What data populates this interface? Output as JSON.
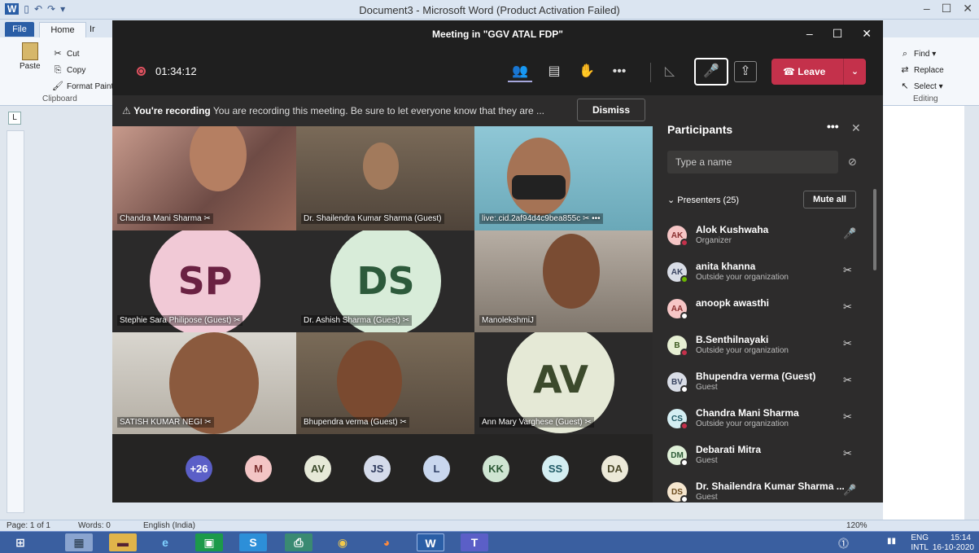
{
  "word": {
    "title": "Document3 - Microsoft Word (Product Activation Failed)",
    "quick_access": [
      "W",
      "▯",
      "↶",
      "↷",
      "▾"
    ],
    "window_controls": [
      "–",
      "☐",
      "✕"
    ],
    "tabs": {
      "file": "File",
      "home": "Home",
      "insert_partial": "Ir"
    },
    "clipboard": {
      "paste": "Paste",
      "cut": "Cut",
      "copy": "Copy",
      "format_painter": "Format Painte",
      "group": "Clipboard"
    },
    "editing": {
      "find": "Find ▾",
      "replace": "Replace",
      "select": "Select ▾",
      "group": "Editing"
    },
    "ruler_corner": "L",
    "status": {
      "page": "Page: 1 of 1",
      "words": "Words: 0",
      "language": "English (India)",
      "zoom": "120%"
    }
  },
  "teams": {
    "window_title": "Meeting in \"GGV ATAL FDP\"",
    "window_controls": [
      "–",
      "☐",
      "✕"
    ],
    "timer": "01:34:12",
    "leave_label": "Leave",
    "recording": {
      "title": "You're recording",
      "message": "You are recording this meeting. Be sure to let everyone know that they are ...",
      "dismiss": "Dismiss"
    },
    "tiles": [
      {
        "name": "Chandra Mani Sharma"
      },
      {
        "name": "Dr. Shailendra Kumar Sharma (Guest)"
      },
      {
        "name": "live:.cid.2af94d4c9bea855c"
      },
      {
        "name": "Stephie Sara Philipose (Guest)",
        "initials": "SP"
      },
      {
        "name": "Dr. Ashish Sharma (Guest)",
        "initials": "DS"
      },
      {
        "name": "ManolekshmiJ"
      },
      {
        "name": "SATISH KUMAR NEGI"
      },
      {
        "name": "Bhupendra verma (Guest)"
      },
      {
        "name": "Ann Mary Varghese (Guest)",
        "initials": "AV"
      }
    ],
    "overflow": [
      {
        "label": "+26",
        "color": "#5b5fc7",
        "text": "#ffffff"
      },
      {
        "label": "M",
        "color": "#f3c5c5",
        "text": "#7a2f2f"
      },
      {
        "label": "AV",
        "color": "#e6e9d8",
        "text": "#3c4a2c"
      },
      {
        "label": "JS",
        "color": "#d5dbea",
        "text": "#2f3a5c"
      },
      {
        "label": "L",
        "color": "#c9d7ee",
        "text": "#2f3f66"
      },
      {
        "label": "KK",
        "color": "#cfe5d2",
        "text": "#2c5a36"
      },
      {
        "label": "SS",
        "color": "#d4eef2",
        "text": "#205a66"
      },
      {
        "label": "DA",
        "color": "#ece9d8",
        "text": "#4d4a2c"
      }
    ],
    "panel": {
      "title": "Participants",
      "more": "•••",
      "close": "✕",
      "search_placeholder": "Type a name",
      "presenters_label": "Presenters (25)",
      "mute_all": "Mute all",
      "people": [
        {
          "initials": "AK",
          "name": "Alok Kushwaha",
          "sub": "Organizer",
          "bg": "#f6c6c6",
          "fg": "#8a2f2f",
          "status": "#c4314b",
          "mic": "🎤"
        },
        {
          "initials": "AK",
          "name": "anita khanna",
          "sub": "Outside your organization",
          "bg": "#d9dde6",
          "fg": "#3a4460",
          "status": "#6bb700",
          "mic": "✂"
        },
        {
          "initials": "AA",
          "name": "anoopk awasthi",
          "sub": "",
          "bg": "#f6c6c6",
          "fg": "#8a2f2f",
          "status": "#ffffff",
          "mic": "✂"
        },
        {
          "initials": "B",
          "name": "B.Senthilnayaki",
          "sub": "Outside your organization",
          "bg": "#e6efd3",
          "fg": "#3c5a20",
          "status": "#c4314b",
          "mic": "✂"
        },
        {
          "initials": "BV",
          "name": "Bhupendra verma (Guest)",
          "sub": "Guest",
          "bg": "#d9dde6",
          "fg": "#3a4460",
          "status": "#ffffff",
          "mic": "✂"
        },
        {
          "initials": "CS",
          "name": "Chandra Mani Sharma",
          "sub": "Outside your organization",
          "bg": "#d4eef2",
          "fg": "#205a66",
          "status": "#c4314b",
          "mic": "✂"
        },
        {
          "initials": "DM",
          "name": "Debarati Mitra",
          "sub": "Guest",
          "bg": "#dff0d8",
          "fg": "#2c5a36",
          "status": "#ffffff",
          "mic": "✂"
        },
        {
          "initials": "DS",
          "name": "Dr. Shailendra Kumar Sharma ...",
          "sub": "Guest",
          "bg": "#f5e6cf",
          "fg": "#6a4a1c",
          "status": "#ffffff",
          "mic": "🎤"
        }
      ]
    }
  },
  "tray": {
    "lang": "ENG",
    "region": "INTL",
    "time": "15:14",
    "date": "16-10-2020"
  }
}
